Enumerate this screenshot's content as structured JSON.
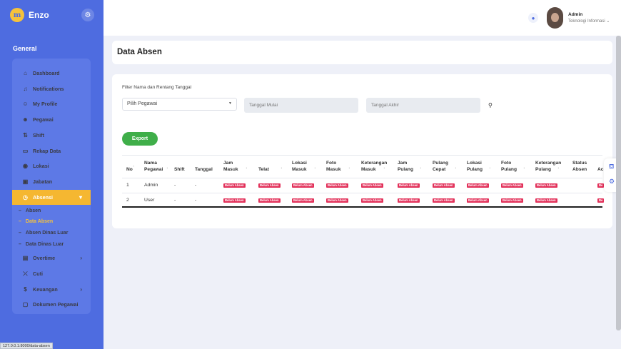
{
  "app": {
    "name": "Enzo",
    "logo": "m"
  },
  "sidebar": {
    "section": "General",
    "items": [
      {
        "label": "Dashboard",
        "icon": "⌂"
      },
      {
        "label": "Notifications",
        "icon": "♫"
      },
      {
        "label": "My Profile",
        "icon": "☺"
      },
      {
        "label": "Pegawai",
        "icon": "☻"
      },
      {
        "label": "Shift",
        "icon": "⇅"
      },
      {
        "label": "Rekap Data",
        "icon": "▭"
      },
      {
        "label": "Lokasi",
        "icon": "◉"
      },
      {
        "label": "Jabatan",
        "icon": "▣"
      },
      {
        "label": "Absensi",
        "icon": "◷",
        "chevron": "▾"
      },
      {
        "label": "Overtime",
        "icon": "▤",
        "chevron": "›"
      },
      {
        "label": "Cuti",
        "icon": "⤫"
      },
      {
        "label": "Keuangan",
        "icon": "$",
        "chevron": "›"
      },
      {
        "label": "Dokumen Pegawai",
        "icon": "▢"
      }
    ],
    "sub_items": [
      {
        "label": "Absen"
      },
      {
        "label": "Data Absen"
      },
      {
        "label": "Absen Dinas Luar"
      },
      {
        "label": "Data Dinas Luar"
      }
    ]
  },
  "topbar": {
    "user_name": "Admin",
    "user_role": "Teknologi Informasi",
    "role_caret": "⌄"
  },
  "page": {
    "title": "Data Absen"
  },
  "filter": {
    "label": "Filter Nama dan Rentang Tanggal",
    "employee_placeholder": "Pilih Pegawai",
    "start_placeholder": "Tanggal Mulai",
    "end_placeholder": "Tanggal Akhir",
    "export_label": "Export"
  },
  "table": {
    "headers": [
      {
        "line1": "No",
        "line2": ""
      },
      {
        "line1": "Nama",
        "line2": "Pegawai"
      },
      {
        "line1": "Shift",
        "line2": ""
      },
      {
        "line1": "Tanggal",
        "line2": ""
      },
      {
        "line1": "Jam",
        "line2": "Masuk"
      },
      {
        "line1": "Telat",
        "line2": ""
      },
      {
        "line1": "Lokasi",
        "line2": "Masuk"
      },
      {
        "line1": "Foto",
        "line2": "Masuk"
      },
      {
        "line1": "Keterangan",
        "line2": "Masuk"
      },
      {
        "line1": "Jam",
        "line2": "Pulang"
      },
      {
        "line1": "Pulang",
        "line2": "Cepat"
      },
      {
        "line1": "Lokasi",
        "line2": "Pulang"
      },
      {
        "line1": "Foto",
        "line2": "Pulang"
      },
      {
        "line1": "Keterangan",
        "line2": "Pulang"
      },
      {
        "line1": "Status",
        "line2": "Absen"
      },
      {
        "line1": "Ac",
        "line2": ""
      }
    ],
    "badge_label": "Belum Absen",
    "action_badge": "Be",
    "rows": [
      {
        "no": "1",
        "name": "Admin",
        "shift": "-",
        "date": "-"
      },
      {
        "no": "2",
        "name": "User",
        "shift": "-",
        "date": "-"
      }
    ]
  },
  "status_url": "127.0.0.1:8000/data-absen"
}
